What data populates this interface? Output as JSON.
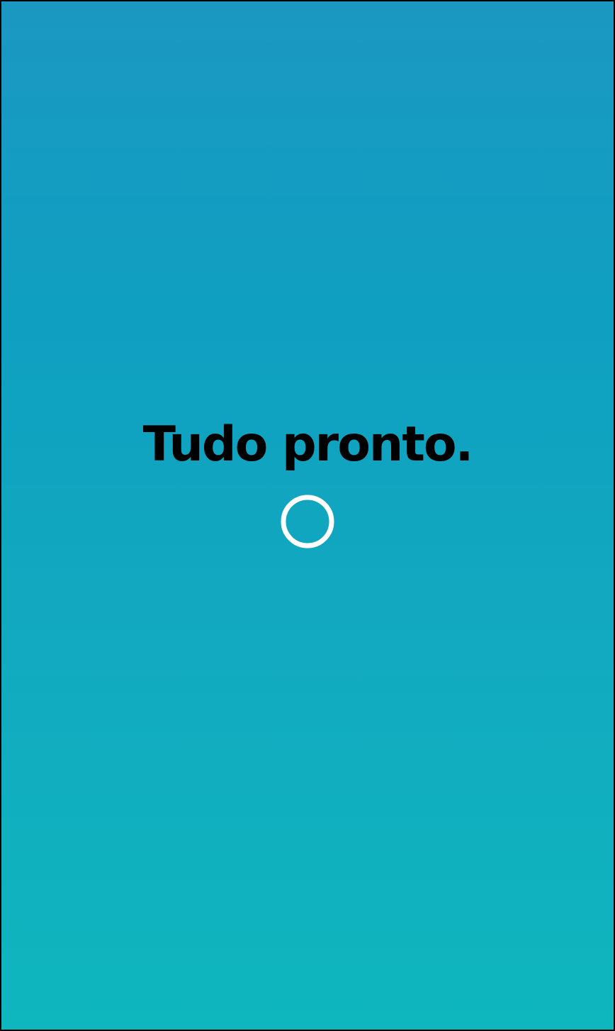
{
  "screen": {
    "message": "Tudo pronto.",
    "spinner_icon": "loading-ring-icon",
    "colors": {
      "gradient_top": "#1b98c2",
      "gradient_bottom": "#0eb6be",
      "text": "#000000",
      "spinner": "#ffffff"
    }
  }
}
